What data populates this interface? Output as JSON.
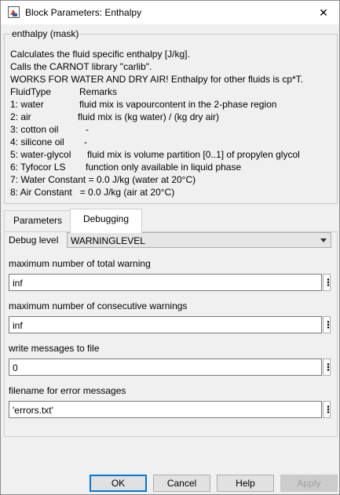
{
  "window": {
    "title": "Block Parameters: Enthalpy",
    "close_glyph": "✕"
  },
  "mask": {
    "title": "enthalpy (mask)",
    "description": [
      "Calculates the fluid specific enthalpy  [J/kg].",
      "Calls the CARNOT library \"carlib\".",
      "WORKS FOR WATER AND DRY AIR! Enthalpy for other fluids is cp*T."
    ],
    "table_header": {
      "col1": "FluidType",
      "col2": "Remarks"
    },
    "table_rows": [
      {
        "col1": "1: water",
        "col2": "fluid mix is vapourcontent in the 2-phase region"
      },
      {
        "col1": "2: air",
        "col2": "fluid mix is (kg water) / (kg dry air)"
      },
      {
        "col1": "3: cotton oil",
        "col2": "-"
      },
      {
        "col1": "4: silicone oil",
        "col2": "-"
      },
      {
        "col1": "5: water-glycol",
        "col2": "fluid mix is volume partition [0..1] of propylen glycol"
      },
      {
        "col1": "6: Tyfocor LS",
        "col2": "function only available in liquid phase"
      }
    ],
    "constants": [
      "7: Water Constant = 0.0 J/kg (water at 20°C)",
      "8: Air Constant   = 0.0 J/kg (air at 20°C)"
    ]
  },
  "tabs": [
    {
      "label": "Parameters",
      "active": false
    },
    {
      "label": "Debugging",
      "active": true
    }
  ],
  "debug_level": {
    "label": "Debug level",
    "value": "WARNINGLEVEL"
  },
  "fields": [
    {
      "label": "maximum number of total warning",
      "value": "inf"
    },
    {
      "label": "maximum number of consecutive warnings",
      "value": "inf"
    },
    {
      "label": "write messages to file",
      "value": "0"
    },
    {
      "label": "filename for error messages",
      "value": "'errors.txt'"
    }
  ],
  "kebab_glyph": "⋮",
  "buttons": {
    "ok": "OK",
    "cancel": "Cancel",
    "help": "Help",
    "apply": "Apply"
  }
}
